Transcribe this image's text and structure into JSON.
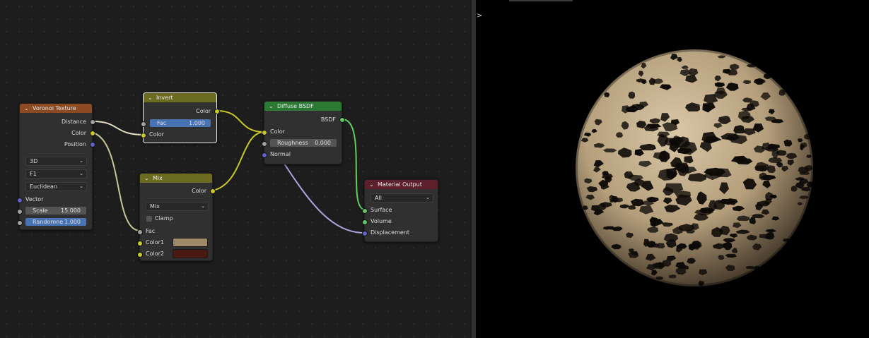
{
  "colors": {
    "header_voronoi": "#8b4a22",
    "header_invert": "#6b6c22",
    "header_mix": "#6b6c22",
    "header_diffuse": "#2a7a33",
    "header_output": "#5e1f2c",
    "color1_swatch": "#9e8a68",
    "color2_swatch": "#4a1a12",
    "wire_grey": "#b5b5b5",
    "wire_yellow": "#c7c729",
    "wire_green": "#5fcf5f",
    "wire_purple": "#a9a6dd"
  },
  "icons": {
    "collapse": "chevron-down-icon",
    "dropdown": "dropdown-arrow-icon",
    "sidebar": "chevron-right-icon"
  },
  "nodes": {
    "voronoi": {
      "title": "Voronoi Texture",
      "out_distance": "Distance",
      "out_color": "Color",
      "out_position": "Position",
      "dim": "3D",
      "feature": "F1",
      "metric": "Euclidean",
      "in_vector": "Vector",
      "scale_label": "Scale",
      "scale_value": "15.000",
      "random_label": "Randomne",
      "random_value": "1.000"
    },
    "invert": {
      "title": "Invert",
      "out_color": "Color",
      "fac_label": "Fac",
      "fac_value": "1.000",
      "in_color": "Color"
    },
    "mix": {
      "title": "Mix",
      "out_color": "Color",
      "blend": "Mix",
      "clamp": "Clamp",
      "in_fac": "Fac",
      "in_color1": "Color1",
      "in_color2": "Color2"
    },
    "diffuse": {
      "title": "Diffuse BSDF",
      "out_bsdf": "BSDF",
      "in_color": "Color",
      "rough_label": "Roughness",
      "rough_value": "0.000",
      "in_normal": "Normal"
    },
    "output": {
      "title": "Material Output",
      "target": "All",
      "in_surface": "Surface",
      "in_volume": "Volume",
      "in_displacement": "Displacement"
    }
  },
  "viewport": {
    "sidebar_toggle": ">"
  }
}
